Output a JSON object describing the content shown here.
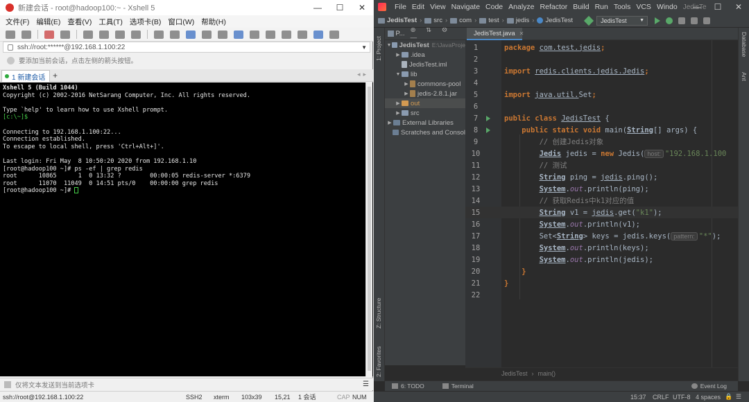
{
  "xshell": {
    "title": "新建会话 - root@hadoop100:~ - Xshell 5",
    "menu": [
      "文件(F)",
      "编辑(E)",
      "查看(V)",
      "工具(T)",
      "选项卡(B)",
      "窗口(W)",
      "帮助(H)"
    ],
    "address": "ssh://root:******@192.168.1.100:22",
    "hint": "要添加当前会话，点击左侧的箭头按钮。",
    "tab": {
      "label": "1 新建会话",
      "add": "+"
    },
    "terminal_lines": [
      {
        "text": "Xshell 5 (Build 1044)",
        "bold": true
      },
      {
        "text": "Copyright (c) 2002-2016 NetSarang Computer, Inc. All rights reserved."
      },
      {
        "text": ""
      },
      {
        "text": "Type `help' to learn how to use Xshell prompt."
      },
      {
        "text": "[c:\\~]$",
        "green": true
      },
      {
        "text": ""
      },
      {
        "text": "Connecting to 192.168.1.100:22..."
      },
      {
        "text": "Connection established."
      },
      {
        "text": "To escape to local shell, press 'Ctrl+Alt+]'."
      },
      {
        "text": ""
      },
      {
        "text": "Last login: Fri May  8 10:50:20 2020 from 192.168.1.10"
      },
      {
        "text": "[root@hadoop100 ~]# ps -ef | grep redis"
      },
      {
        "text": "root      10865      1  0 13:32 ?        00:00:05 redis-server *:6379"
      },
      {
        "text": "root      11070  11049  0 14:51 pts/0    00:00:00 grep redis"
      },
      {
        "text": "[root@hadoop100 ~]# ",
        "cursor": true
      }
    ],
    "compose_placeholder": "仅将文本发送到当前选项卡",
    "status": {
      "connection": "ssh://root@192.168.1.100:22",
      "protocol": "SSH2",
      "term": "xterm",
      "size": "103x39",
      "pos": "15,21",
      "sessions": "1 会话",
      "caps": "CAP",
      "num": "NUM"
    }
  },
  "idea": {
    "menu": [
      "File",
      "Edit",
      "View",
      "Navigate",
      "Code",
      "Analyze",
      "Refactor",
      "Build",
      "Run",
      "Tools",
      "VCS",
      "Windo"
    ],
    "window_title": "JedisTe",
    "breadcrumbs": [
      "JedisTest",
      "src",
      "com",
      "test",
      "jedis",
      "JedisTest"
    ],
    "run_config": "JedisTest",
    "left_tools": [
      "1: Project",
      "Z: Structure",
      "2: Favorites"
    ],
    "right_tools": [
      "Database",
      "Ant"
    ],
    "project_header": "P...",
    "project_tree": [
      {
        "label": "JedisTest",
        "hint": "E:\\JavaProje",
        "indent": 0,
        "arrow": "▼",
        "icon": "fold"
      },
      {
        "label": ".idea",
        "indent": 1,
        "arrow": "▶",
        "icon": "fold"
      },
      {
        "label": "JedisTest.iml",
        "indent": 1,
        "arrow": "",
        "icon": "file"
      },
      {
        "label": "lib",
        "indent": 1,
        "arrow": "▼",
        "icon": "fold"
      },
      {
        "label": "commons-pool",
        "indent": 2,
        "arrow": "▶",
        "icon": "jar"
      },
      {
        "label": "jedis-2.8.1.jar",
        "indent": 2,
        "arrow": "▶",
        "icon": "jar"
      },
      {
        "label": "out",
        "indent": 1,
        "arrow": "▶",
        "icon": "fold-o",
        "selected": true,
        "orange": true
      },
      {
        "label": "src",
        "indent": 1,
        "arrow": "▶",
        "icon": "fold"
      },
      {
        "label": "External Libraries",
        "indent": 0,
        "arrow": "▶",
        "icon": "lib"
      },
      {
        "label": "Scratches and Consol",
        "indent": 0,
        "arrow": "",
        "icon": "lib"
      }
    ],
    "editor_tab": "JedisTest.java",
    "code_lines": [
      {
        "n": "1"
      },
      {
        "n": "2"
      },
      {
        "n": "3"
      },
      {
        "n": "4"
      },
      {
        "n": "5"
      },
      {
        "n": "6"
      },
      {
        "n": "7"
      },
      {
        "n": "8"
      },
      {
        "n": "9"
      },
      {
        "n": "10"
      },
      {
        "n": "11"
      },
      {
        "n": "12"
      },
      {
        "n": "13"
      },
      {
        "n": "14"
      },
      {
        "n": "15"
      },
      {
        "n": "16"
      },
      {
        "n": "17"
      },
      {
        "n": "18"
      },
      {
        "n": "19"
      },
      {
        "n": "20"
      },
      {
        "n": "21"
      },
      {
        "n": "22"
      }
    ],
    "code_text": {
      "l1_kw": "package",
      "l1_rest": "com.test.jedis",
      "l3_kw": "import",
      "l3_rest": "redis.clients.jedis.Jedis",
      "l5_kw": "import",
      "l5_rest": "java.util.",
      "l5_cls": "Set",
      "l7_kw": "public class",
      "l7_name": "JedisTest",
      "l8_kw": "public static void",
      "l8_fn": "main",
      "l8_type": "String",
      "l8_rest": "[] args) {",
      "l9": "// 创建Jedis对象",
      "l10_type": "Jedis",
      "l10_var": "jedis",
      "l10_kw": "new",
      "l10_cls": "Jedis",
      "l10_hint": "host:",
      "l10_str": "\"192.168.1.100",
      "l11": "// 测试",
      "l12_type": "String",
      "l12_rest": "ping = ",
      "l12_obj": "jedis",
      "l12_call": ".ping();",
      "l13_sys": "System",
      "l13_out": "out",
      "l13_call": ".println(ping);",
      "l14": "// 获取Redis中k1对应的值",
      "l15_type": "String",
      "l15_rest": "v1 = ",
      "l15_obj": "jedis",
      "l15_call": ".get(",
      "l15_str": "\"k1\"",
      "l15_end": ");",
      "l16_sys": "System",
      "l16_out": "out",
      "l16_call": ".println(v1);",
      "l17_a": "Set<",
      "l17_type": "String",
      "l17_b": "> keys = jedis.keys(",
      "l17_hint": "pattern:",
      "l17_str": "\"*\"",
      "l17_end": ");",
      "l18_sys": "System",
      "l18_out": "out",
      "l18_call": ".println(keys);",
      "l19_sys": "System",
      "l19_out": "out",
      "l19_call": ".println(jedis);",
      "l20": "}",
      "l21": "}"
    },
    "editor_breadcrumb": [
      "JedisTest",
      "main()"
    ],
    "tool_windows": [
      "6: TODO",
      "Terminal"
    ],
    "event_log": "Event Log",
    "status": {
      "pos": "15:37",
      "line_sep": "CRLF",
      "encoding": "UTF-8",
      "indent": "4 spaces"
    }
  }
}
